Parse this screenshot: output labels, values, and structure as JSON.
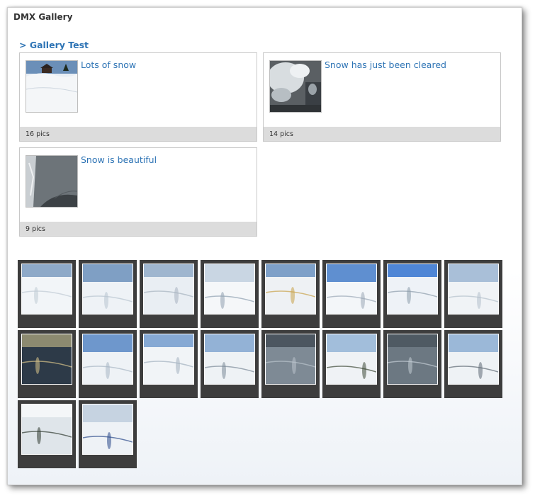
{
  "app": {
    "title": "DMX Gallery"
  },
  "gallery": {
    "title": "> Gallery Test"
  },
  "albums": [
    {
      "name": "Lots of snow",
      "count": "16 pics",
      "thumb_icon": "snow-hill-house-thumbnail"
    },
    {
      "name": "Snow has just been cleared",
      "count": "14 pics",
      "thumb_icon": "snow-clearing-thumbnail"
    },
    {
      "name": "Snow is beautiful",
      "count": "9 pics",
      "thumb_icon": "snowy-slope-thumbnail"
    }
  ],
  "photos": [
    {
      "icon": "child-in-snow-photo"
    },
    {
      "icon": "child-walking-snow-photo"
    },
    {
      "icon": "snowy-village-photo"
    },
    {
      "icon": "snowy-slope-trees-photo"
    },
    {
      "icon": "chalet-in-snow-photo"
    },
    {
      "icon": "shadow-on-snow-photo"
    },
    {
      "icon": "shadow-blue-sky-photo"
    },
    {
      "icon": "snow-field-horizon-photo"
    },
    {
      "icon": "sunset-over-valley-photo"
    },
    {
      "icon": "ski-slope-shadows-photo"
    },
    {
      "icon": "snow-plain-shadow-photo"
    },
    {
      "icon": "snowy-hill-treeline-photo"
    },
    {
      "icon": "ski-tracks-closeup-photo"
    },
    {
      "icon": "snow-mountain-ridge-photo"
    },
    {
      "icon": "snow-slope-skier-photo"
    },
    {
      "icon": "snow-meadow-trees-photo"
    },
    {
      "icon": "forest-ridge-snow-photo"
    },
    {
      "icon": "skier-in-blue-photo"
    }
  ],
  "colors": {
    "link": "#2e74b5",
    "tile": "#3d3d3d",
    "footer": "#dcdcdc"
  }
}
